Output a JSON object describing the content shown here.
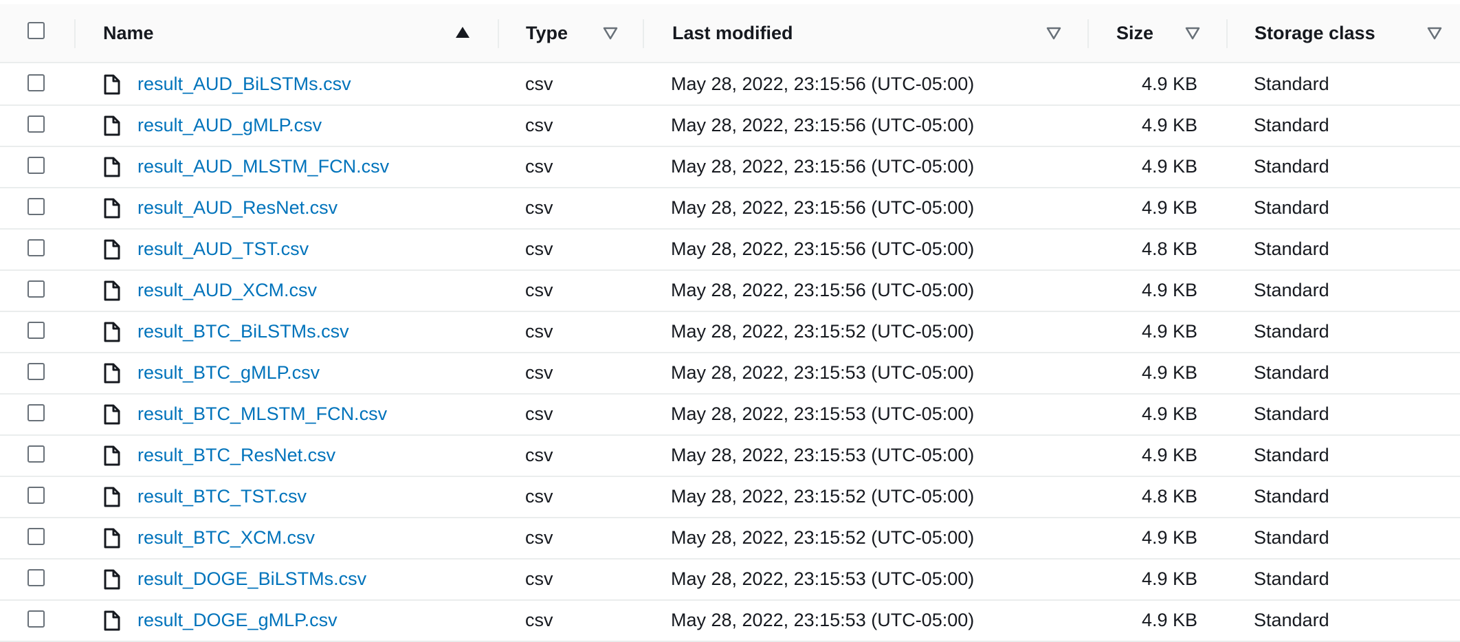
{
  "header": {
    "name": "Name",
    "type": "Type",
    "last_modified": "Last modified",
    "size": "Size",
    "storage_class": "Storage class",
    "name_sort_icon": "sort-ascending-icon",
    "filter_icon": "sort-descending-outline-icon"
  },
  "file_icon": "file-icon",
  "rows": [
    {
      "name": "result_AUD_BiLSTMs.csv",
      "type": "csv",
      "last_modified": "May 28, 2022, 23:15:56 (UTC-05:00)",
      "size": "4.9 KB",
      "storage_class": "Standard"
    },
    {
      "name": "result_AUD_gMLP.csv",
      "type": "csv",
      "last_modified": "May 28, 2022, 23:15:56 (UTC-05:00)",
      "size": "4.9 KB",
      "storage_class": "Standard"
    },
    {
      "name": "result_AUD_MLSTM_FCN.csv",
      "type": "csv",
      "last_modified": "May 28, 2022, 23:15:56 (UTC-05:00)",
      "size": "4.9 KB",
      "storage_class": "Standard"
    },
    {
      "name": "result_AUD_ResNet.csv",
      "type": "csv",
      "last_modified": "May 28, 2022, 23:15:56 (UTC-05:00)",
      "size": "4.9 KB",
      "storage_class": "Standard"
    },
    {
      "name": "result_AUD_TST.csv",
      "type": "csv",
      "last_modified": "May 28, 2022, 23:15:56 (UTC-05:00)",
      "size": "4.8 KB",
      "storage_class": "Standard"
    },
    {
      "name": "result_AUD_XCM.csv",
      "type": "csv",
      "last_modified": "May 28, 2022, 23:15:56 (UTC-05:00)",
      "size": "4.9 KB",
      "storage_class": "Standard"
    },
    {
      "name": "result_BTC_BiLSTMs.csv",
      "type": "csv",
      "last_modified": "May 28, 2022, 23:15:52 (UTC-05:00)",
      "size": "4.9 KB",
      "storage_class": "Standard"
    },
    {
      "name": "result_BTC_gMLP.csv",
      "type": "csv",
      "last_modified": "May 28, 2022, 23:15:53 (UTC-05:00)",
      "size": "4.9 KB",
      "storage_class": "Standard"
    },
    {
      "name": "result_BTC_MLSTM_FCN.csv",
      "type": "csv",
      "last_modified": "May 28, 2022, 23:15:53 (UTC-05:00)",
      "size": "4.9 KB",
      "storage_class": "Standard"
    },
    {
      "name": "result_BTC_ResNet.csv",
      "type": "csv",
      "last_modified": "May 28, 2022, 23:15:53 (UTC-05:00)",
      "size": "4.9 KB",
      "storage_class": "Standard"
    },
    {
      "name": "result_BTC_TST.csv",
      "type": "csv",
      "last_modified": "May 28, 2022, 23:15:52 (UTC-05:00)",
      "size": "4.8 KB",
      "storage_class": "Standard"
    },
    {
      "name": "result_BTC_XCM.csv",
      "type": "csv",
      "last_modified": "May 28, 2022, 23:15:52 (UTC-05:00)",
      "size": "4.9 KB",
      "storage_class": "Standard"
    },
    {
      "name": "result_DOGE_BiLSTMs.csv",
      "type": "csv",
      "last_modified": "May 28, 2022, 23:15:53 (UTC-05:00)",
      "size": "4.9 KB",
      "storage_class": "Standard"
    },
    {
      "name": "result_DOGE_gMLP.csv",
      "type": "csv",
      "last_modified": "May 28, 2022, 23:15:53 (UTC-05:00)",
      "size": "4.9 KB",
      "storage_class": "Standard"
    }
  ]
}
